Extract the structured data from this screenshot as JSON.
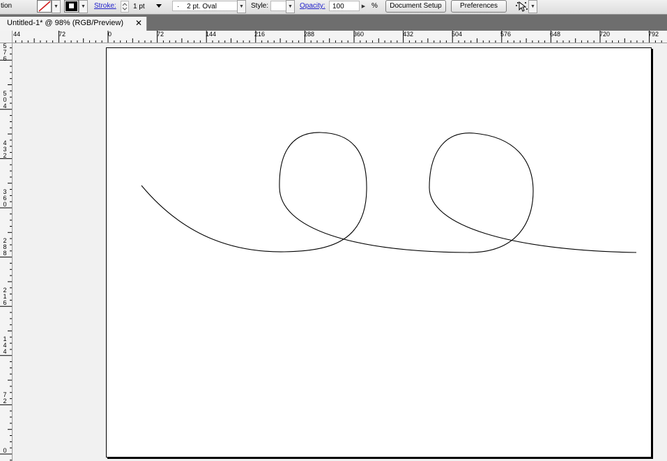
{
  "control_bar": {
    "workspace_label": "tion",
    "stroke_label": "Stroke:",
    "stroke_weight": "1 pt",
    "brush_definition": "2 pt. Oval",
    "brush_dot": "·",
    "style_label": "Style:",
    "opacity_label": "Opacity:",
    "opacity_value": "100",
    "percent_sign": "%",
    "document_setup_label": "Document Setup",
    "preferences_label": "Preferences"
  },
  "tabs": [
    {
      "label": "Untitled-1* @ 98% (RGB/Preview)",
      "close": "✕"
    }
  ],
  "rulers": {
    "horizontal": [
      "44",
      "72",
      "0",
      "72",
      "144",
      "216",
      "288",
      "360",
      "432",
      "504",
      "576",
      "648",
      "720",
      "792"
    ],
    "vertical": [
      "5\n7\n6",
      "5\n0\n4",
      "4\n3\n2",
      "3\n6\n0",
      "2\n8\n8",
      "2\n1\n6",
      "1\n4\n4",
      "7\n2",
      "0"
    ]
  },
  "colors": {
    "fill_none_slash": "#d11a1a",
    "stroke_swatch": "#000000",
    "path_stroke": "#000000",
    "link_blue": "#2222cc"
  },
  "icons": {
    "stroke_spinner": "spinner-icon",
    "selection_tool": "selection-options-icon"
  }
}
